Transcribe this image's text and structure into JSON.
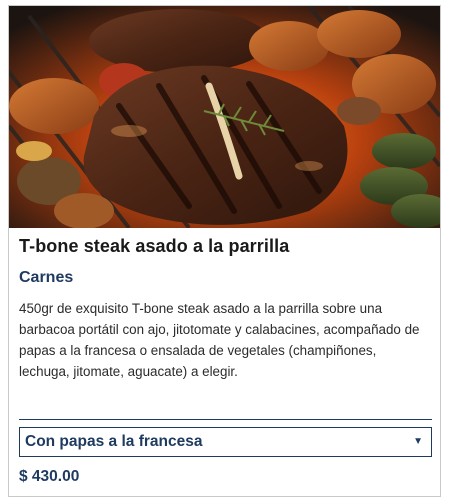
{
  "product": {
    "image_alt": "T-bone steak on grill with vegetables",
    "title": "T-bone steak asado a la parrilla",
    "category": "Carnes",
    "description": "450gr de exquisito T-bone steak asado a la parrilla sobre una barbacoa portátil con ajo, jitotomate y calabacines, acompañado de papas a la francesa o ensalada de vegetales (champiñones, lechuga, jitomate, aguacate) a elegir.",
    "option_selected": "Con papas a la francesa",
    "price": "$ 430.00"
  },
  "icons": {
    "dropdown": "chevron-down-icon"
  },
  "colors": {
    "accent": "#1e3a5f",
    "text": "#2b2b2b",
    "border": "#c9c9c9"
  }
}
